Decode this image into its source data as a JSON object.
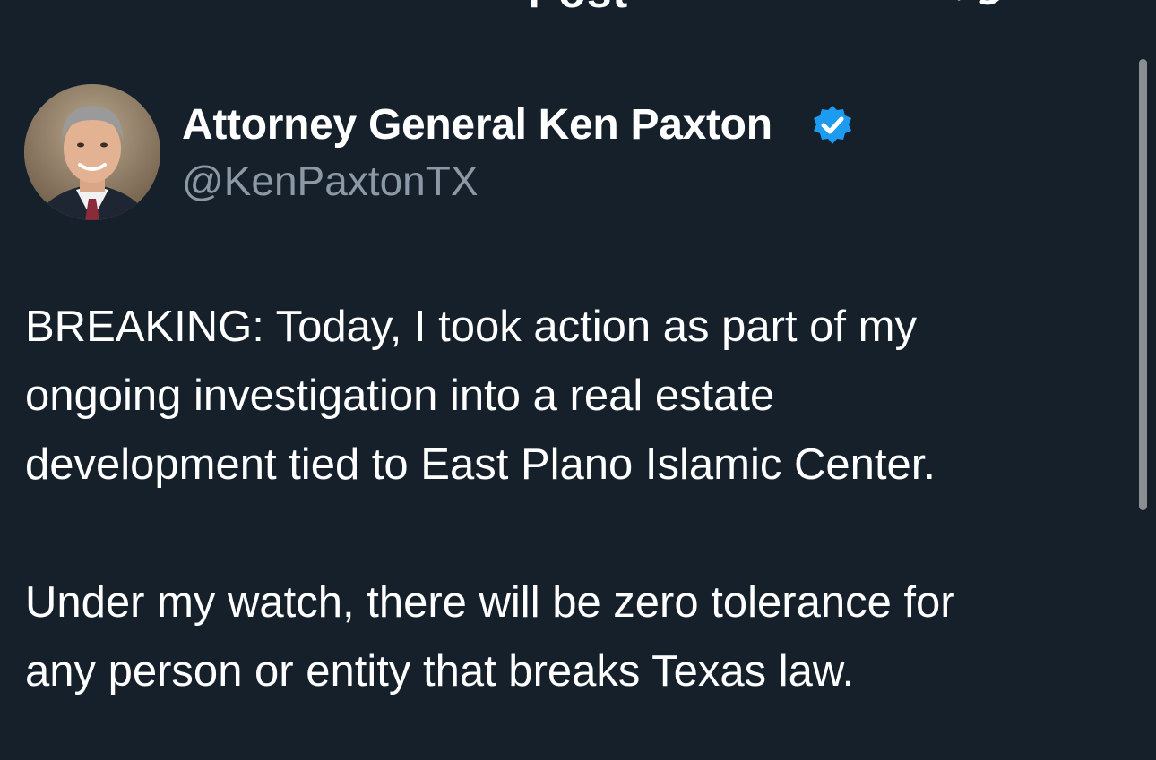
{
  "header": {
    "title": "Post",
    "back_icon": "chevron-left-icon",
    "refresh_icon": "refresh-icon"
  },
  "author": {
    "name": "Attorney General Ken Paxton",
    "handle": "@KenPaxtonTX",
    "verified": true,
    "verified_color": "#1d9bf0"
  },
  "post": {
    "paragraphs": [
      {
        "lines": [
          "BREAKING: Today, I took action as part of my",
          "ongoing investigation into a real estate",
          "development tied to East Plano Islamic Center."
        ]
      },
      {
        "lines": [
          "Under my watch, there will be zero tolerance for",
          "any person or entity that breaks Texas law."
        ]
      }
    ]
  },
  "colors": {
    "background": "#15202b",
    "text": "#ffffff",
    "secondary_text": "#8b98a5",
    "scrollbar": "#8a8e93"
  }
}
